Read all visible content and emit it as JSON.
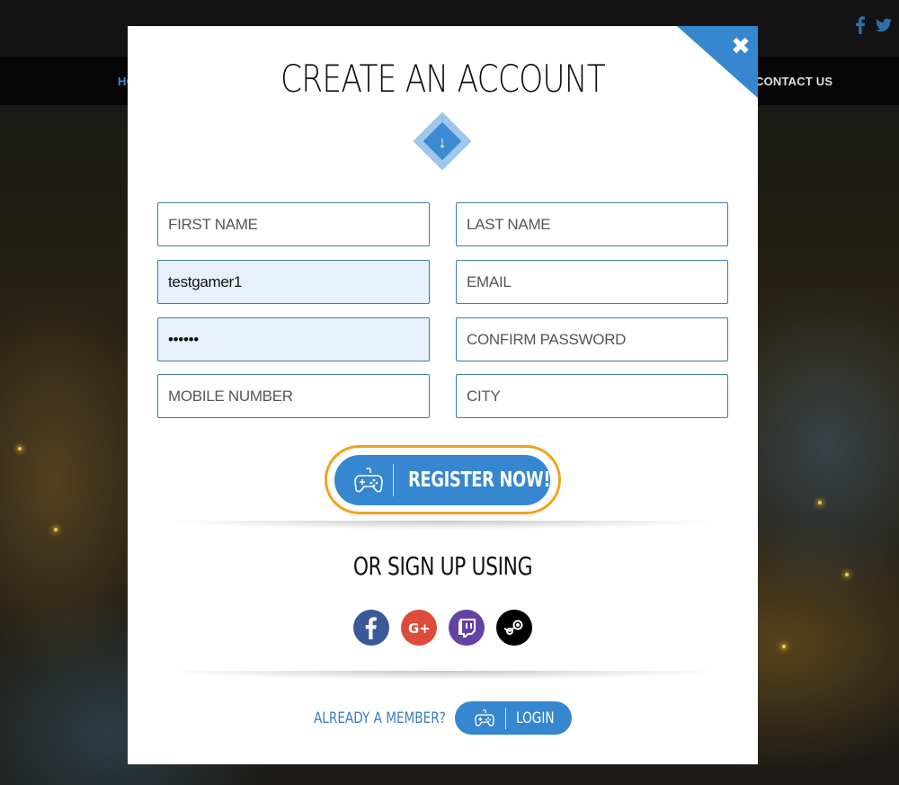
{
  "background": {
    "nav": {
      "left_item_fragment": "HO",
      "right_item": "CONTACT US"
    },
    "social_icons": [
      "facebook-icon",
      "twitter-icon"
    ]
  },
  "modal": {
    "title": "CREATE AN ACCOUNT",
    "close_symbol": "✖",
    "arrow_symbol": "↓",
    "fields": {
      "first_name": {
        "placeholder": "FIRST NAME",
        "value": ""
      },
      "last_name": {
        "placeholder": "LAST NAME",
        "value": ""
      },
      "username": {
        "placeholder": "",
        "value": "testgamer1"
      },
      "email": {
        "placeholder": "EMAIL",
        "value": ""
      },
      "password": {
        "placeholder": "",
        "value": "••••••"
      },
      "confirm_password": {
        "placeholder": "CONFIRM PASSWORD",
        "value": ""
      },
      "mobile": {
        "placeholder": "MOBILE NUMBER",
        "value": ""
      },
      "city": {
        "placeholder": "CITY",
        "value": ""
      }
    },
    "register_label": "REGISTER NOW!",
    "signup_heading": "OR SIGN UP USING",
    "social_providers": [
      {
        "name": "facebook",
        "color": "#3b5998"
      },
      {
        "name": "google-plus",
        "color": "#dd4b39"
      },
      {
        "name": "twitch",
        "color": "#6441a5"
      },
      {
        "name": "steam",
        "color": "#000000"
      }
    ],
    "already_member": "ALREADY A MEMBER?",
    "login_label": "LOGIN"
  },
  "colors": {
    "accent": "#3687cf",
    "highlight_ring": "#f2a11c",
    "filled_field": "#e8f0fd"
  }
}
